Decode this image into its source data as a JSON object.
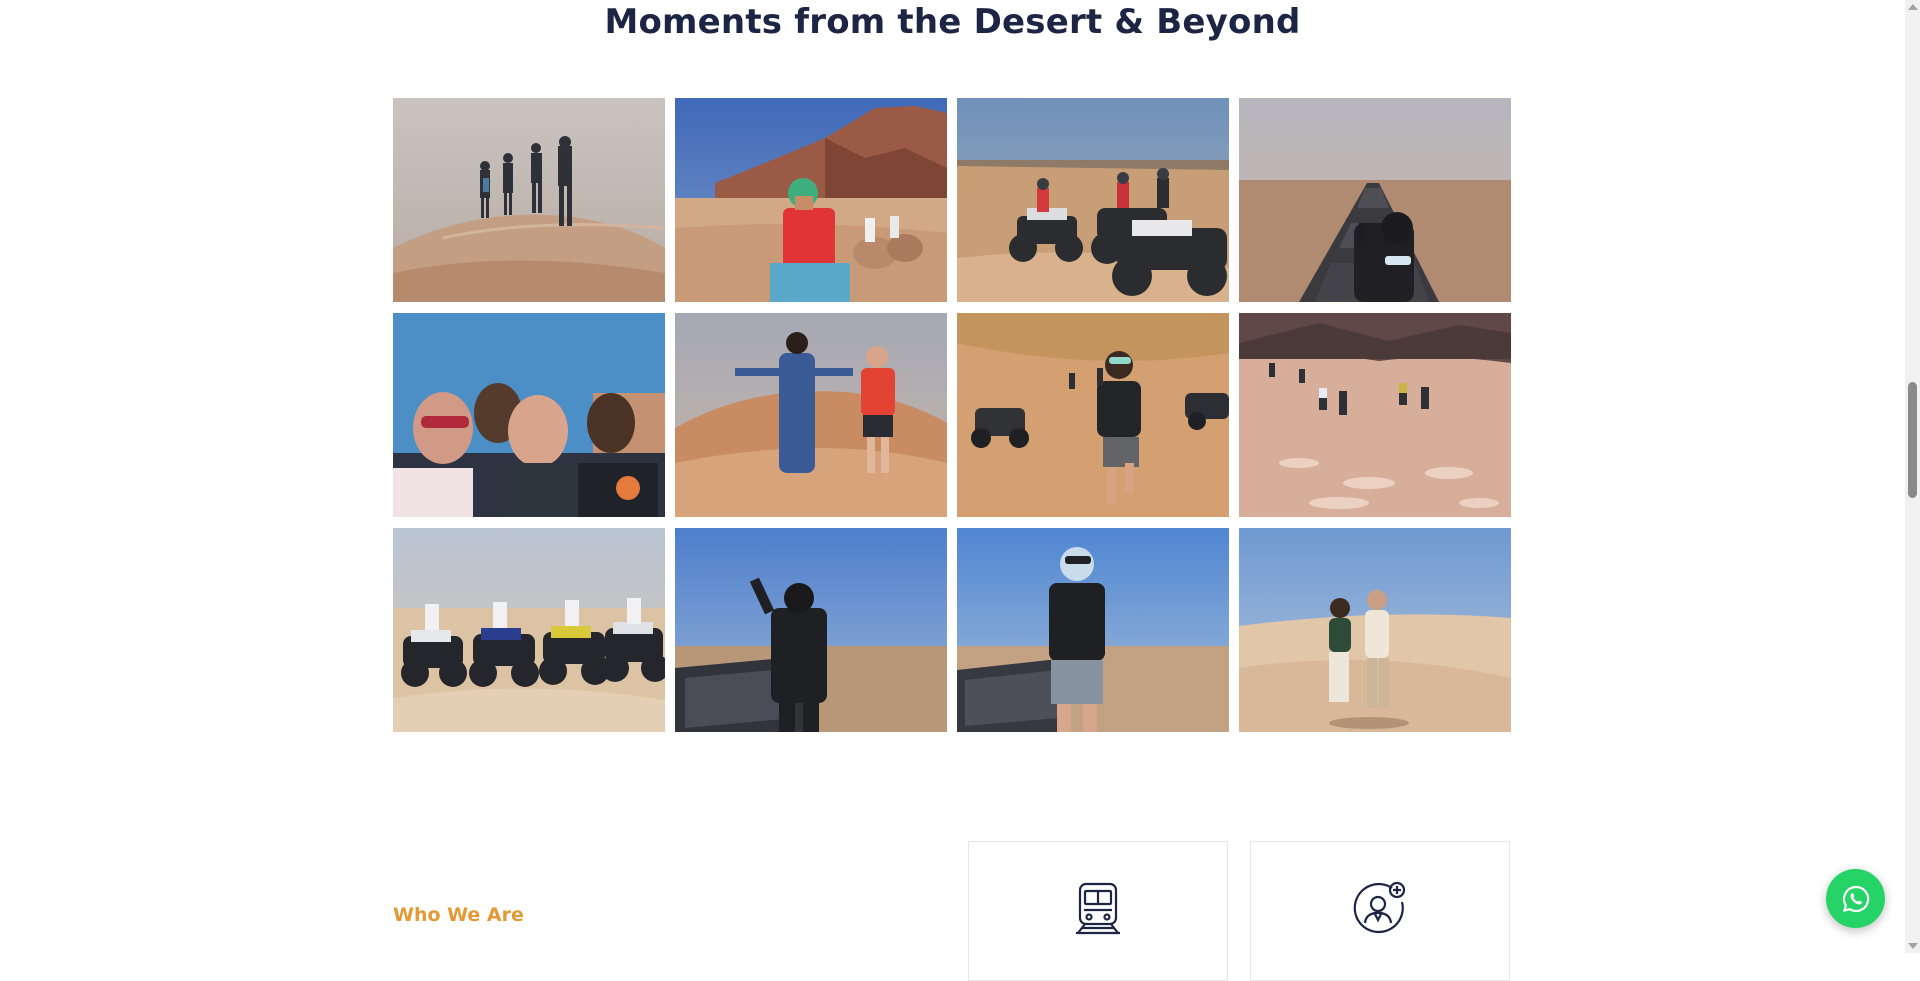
{
  "section": {
    "title": "Moments from the Desert & Beyond"
  },
  "gallery": {
    "photos": [
      {
        "name": "dune-hikers-photo"
      },
      {
        "name": "camel-caravan-photo"
      },
      {
        "name": "quad-bike-group-photo"
      },
      {
        "name": "iron-ore-train-rider-photo"
      },
      {
        "name": "group-selfie-photo"
      },
      {
        "name": "dune-pose-photo"
      },
      {
        "name": "buggy-dune-run-photo"
      },
      {
        "name": "sand-dune-running-photo"
      },
      {
        "name": "quad-bike-riders-photo"
      },
      {
        "name": "train-wagon-pose-photo"
      },
      {
        "name": "train-wagon-standing-photo"
      },
      {
        "name": "dune-dance-photo"
      }
    ]
  },
  "about": {
    "eyebrow": "Who We Are"
  },
  "features": [
    {
      "icon": "train-icon"
    },
    {
      "icon": "guide-profile-icon"
    }
  ],
  "floating": {
    "icon": "whatsapp-icon"
  },
  "colors": {
    "title": "#1c2544",
    "accent": "#e39a34",
    "whatsapp": "#25d366"
  }
}
